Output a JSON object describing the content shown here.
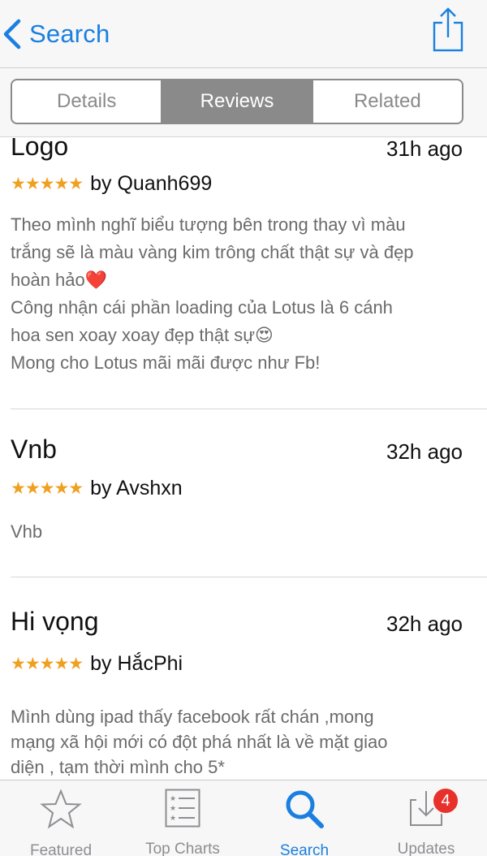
{
  "nav": {
    "back_label": "Search"
  },
  "segments": {
    "items": [
      "Details",
      "Reviews",
      "Related"
    ],
    "selected": "Reviews"
  },
  "reviews": [
    {
      "title": "Logo",
      "date": "31h ago",
      "stars": "★★★★★",
      "rating": 5,
      "author": "by Quanh699",
      "body": [
        "Theo mình nghĩ biểu tượng bên trong thay vì màu",
        "trắng sẽ là màu vàng kim trông chất thật sự và đẹp",
        "hoàn hảo❤️",
        "Công nhận cái phần loading của Lotus là 6 cánh",
        "hoa sen xoay xoay đẹp thật sự😍",
        "Mong cho Lotus mãi mãi được như Fb!"
      ]
    },
    {
      "title": "Vnb",
      "date": "32h ago",
      "stars": "★★★★★",
      "rating": 5,
      "author": "by Avshxn",
      "body": [
        "Vhb"
      ]
    },
    {
      "title": "Hi vọng",
      "date": "32h ago",
      "stars": "★★★★★",
      "rating": 5,
      "author": "by HắcPhi",
      "body": [
        "Mình dùng ipad thấy facebook rất chán ,mong",
        "mạng xã hội mới có đột phá nhất là về mặt giao",
        "diện , tạm thời mình cho 5*"
      ]
    }
  ],
  "tabbar": {
    "tabs": [
      {
        "label": "Featured",
        "icon": "star-outline-icon"
      },
      {
        "label": "Top Charts",
        "icon": "list-icon"
      },
      {
        "label": "Search",
        "icon": "search-icon"
      },
      {
        "label": "Updates",
        "icon": "download-tray-icon",
        "badge": "4"
      }
    ],
    "active": "Search"
  },
  "colors": {
    "accent": "#1a7fe0",
    "star": "#f0a020",
    "badge": "#e8312a",
    "segment": "#8a8a8a"
  }
}
